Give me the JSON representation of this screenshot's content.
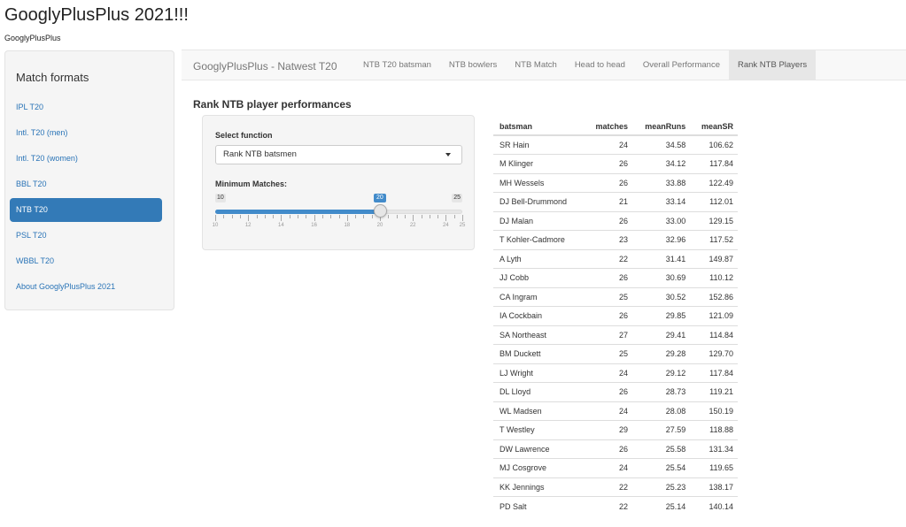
{
  "header": {
    "title": "GooglyPlusPlus 2021!!!",
    "subtitle": "GooglyPlusPlus"
  },
  "sidebar": {
    "title": "Match formats",
    "items": [
      {
        "label": "IPL T20",
        "active": false
      },
      {
        "label": "Intl. T20 (men)",
        "active": false
      },
      {
        "label": "Intl. T20 (women)",
        "active": false
      },
      {
        "label": "BBL T20",
        "active": false
      },
      {
        "label": "NTB T20",
        "active": true
      },
      {
        "label": "PSL T20",
        "active": false
      },
      {
        "label": "WBBL T20",
        "active": false
      },
      {
        "label": "About GooglyPlusPlus 2021",
        "active": false
      }
    ]
  },
  "navbar": {
    "brand": "GooglyPlusPlus - Natwest T20",
    "tabs": [
      {
        "label": "NTB T20 batsman",
        "active": false
      },
      {
        "label": "NTB bowlers",
        "active": false
      },
      {
        "label": "NTB Match",
        "active": false
      },
      {
        "label": "Head to head",
        "active": false
      },
      {
        "label": "Overall Performance",
        "active": false
      },
      {
        "label": "Rank NTB Players",
        "active": true
      }
    ]
  },
  "main": {
    "section_title": "Rank NTB player performances",
    "select_label": "Select function",
    "select_value": "Rank NTB batsmen",
    "slider": {
      "label": "Minimum Matches:",
      "min": 10,
      "max": 25,
      "value": 20,
      "tick_labels": [
        "10",
        "12",
        "14",
        "16",
        "18",
        "20",
        "22",
        "24",
        "25"
      ]
    }
  },
  "table": {
    "columns": [
      "batsman",
      "matches",
      "meanRuns",
      "meanSR"
    ],
    "rows": [
      [
        "SR Hain",
        "24",
        "34.58",
        "106.62"
      ],
      [
        "M Klinger",
        "26",
        "34.12",
        "117.84"
      ],
      [
        "MH Wessels",
        "26",
        "33.88",
        "122.49"
      ],
      [
        "DJ Bell-Drummond",
        "21",
        "33.14",
        "112.01"
      ],
      [
        "DJ Malan",
        "26",
        "33.00",
        "129.15"
      ],
      [
        "T Kohler-Cadmore",
        "23",
        "32.96",
        "117.52"
      ],
      [
        "A Lyth",
        "22",
        "31.41",
        "149.87"
      ],
      [
        "JJ Cobb",
        "26",
        "30.69",
        "110.12"
      ],
      [
        "CA Ingram",
        "25",
        "30.52",
        "152.86"
      ],
      [
        "IA Cockbain",
        "26",
        "29.85",
        "121.09"
      ],
      [
        "SA Northeast",
        "27",
        "29.41",
        "114.84"
      ],
      [
        "BM Duckett",
        "25",
        "29.28",
        "129.70"
      ],
      [
        "LJ Wright",
        "24",
        "29.12",
        "117.84"
      ],
      [
        "DL Lloyd",
        "26",
        "28.73",
        "119.21"
      ],
      [
        "WL Madsen",
        "24",
        "28.08",
        "150.19"
      ],
      [
        "T Westley",
        "29",
        "27.59",
        "118.88"
      ],
      [
        "DW Lawrence",
        "26",
        "25.58",
        "131.34"
      ],
      [
        "MJ Cosgrove",
        "24",
        "25.54",
        "119.65"
      ],
      [
        "KK Jennings",
        "22",
        "25.23",
        "138.17"
      ],
      [
        "PD Salt",
        "22",
        "25.14",
        "140.14"
      ]
    ]
  },
  "colors": {
    "accent": "#337ab7",
    "link": "#2a74b7"
  }
}
